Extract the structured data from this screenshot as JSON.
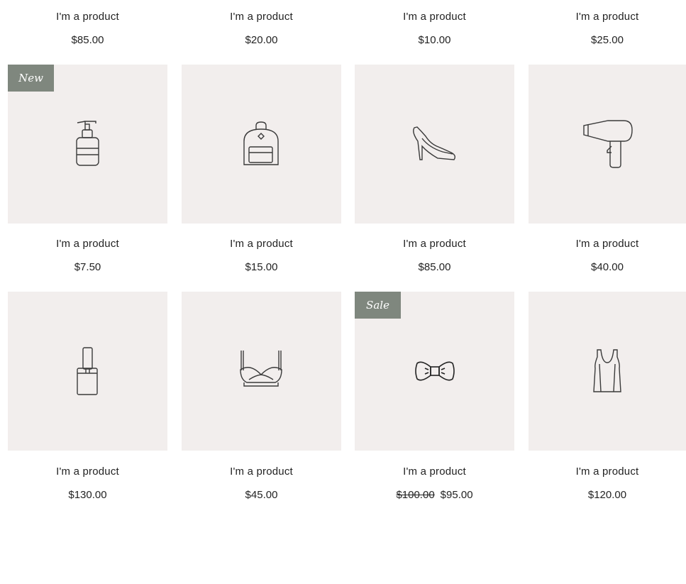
{
  "top_row": [
    {
      "name": "I'm a product",
      "price": "$85.00"
    },
    {
      "name": "I'm a product",
      "price": "$20.00"
    },
    {
      "name": "I'm a product",
      "price": "$10.00"
    },
    {
      "name": "I'm a product",
      "price": "$25.00"
    }
  ],
  "row2": [
    {
      "name": "I'm a product",
      "price": "$7.50",
      "ribbon": "New",
      "icon": "soap-dispenser-icon"
    },
    {
      "name": "I'm a product",
      "price": "$15.00",
      "icon": "backpack-icon"
    },
    {
      "name": "I'm a product",
      "price": "$85.00",
      "icon": "high-heel-shoe-icon"
    },
    {
      "name": "I'm a product",
      "price": "$40.00",
      "icon": "hair-dryer-icon"
    }
  ],
  "row3": [
    {
      "name": "I'm a product",
      "price": "$130.00",
      "icon": "perfume-bottle-icon"
    },
    {
      "name": "I'm a product",
      "price": "$45.00",
      "icon": "bra-icon"
    },
    {
      "name": "I'm a product",
      "old_price": "$100.00",
      "price": "$95.00",
      "ribbon": "Sale",
      "icon": "bow-tie-icon"
    },
    {
      "name": "I'm a product",
      "price": "$120.00",
      "icon": "tank-top-icon"
    }
  ],
  "colors": {
    "tile_bg": "#f2eeed",
    "ribbon_bg": "#7f877e",
    "text": "#232323"
  }
}
